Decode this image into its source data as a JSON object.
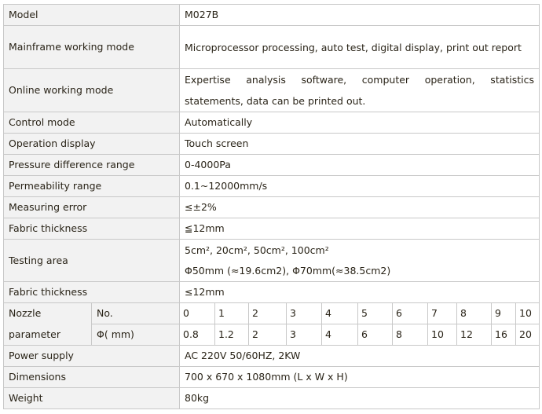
{
  "rows": {
    "model": {
      "label": "Model",
      "value": "M027B"
    },
    "mainframe": {
      "label": "Mainframe working mode",
      "value": "Microprocessor processing, auto test, digital display, print out report"
    },
    "online": {
      "label": "Online working mode",
      "value": "Expertise analysis software, computer operation, statistics statements, data can be printed out."
    },
    "control": {
      "label": "Control mode",
      "value": "Automatically"
    },
    "display": {
      "label": "Operation display",
      "value": "Touch screen"
    },
    "pressure": {
      "label": "Pressure difference range",
      "value": "0-4000Pa"
    },
    "permeability": {
      "label": "Permeability range",
      "value": "0.1~12000mm/s"
    },
    "error": {
      "label": "Measuring error",
      "value": "≤±2%"
    },
    "thickness1": {
      "label": "Fabric thickness",
      "value": "≦12mm"
    },
    "area": {
      "label": "Testing area",
      "value_line1": "5cm², 20cm², 50cm², 100cm²",
      "value_line2": "Φ50mm (≈19.6cm2), Φ70mm(≈38.5cm2)"
    },
    "thickness2": {
      "label": "Fabric thickness",
      "value": "≤12mm"
    },
    "power": {
      "label": "Power supply",
      "value": "AC 220V 50/60HZ, 2KW"
    },
    "dimensions": {
      "label": "Dimensions",
      "value": "700 x 670 x 1080mm (L x W x H)"
    },
    "weight": {
      "label": "Weight",
      "value": "80kg"
    }
  },
  "nozzle": {
    "label_line1": "Nozzle",
    "label_line2": "parameter",
    "no_label": "No.",
    "dia_label": "Φ( mm)",
    "numbers": [
      "0",
      "1",
      "2",
      "3",
      "4",
      "5",
      "6",
      "7",
      "8",
      "9",
      "10"
    ],
    "diameters": [
      "0.8",
      "1.2",
      "2",
      "3",
      "4",
      "6",
      "8",
      "10",
      "12",
      "16",
      "20"
    ]
  }
}
